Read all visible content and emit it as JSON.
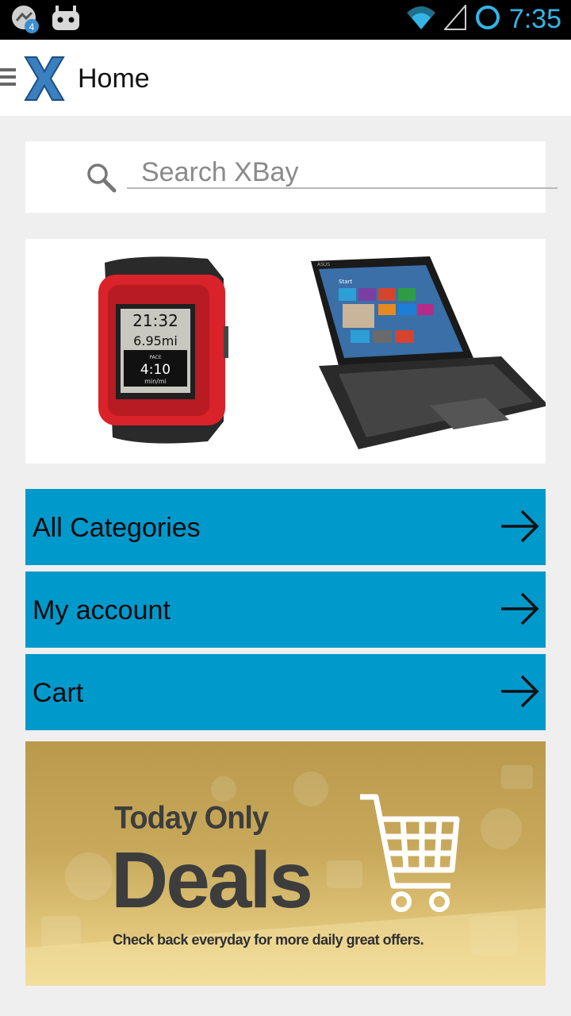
{
  "status_bar": {
    "notification_count": "4",
    "time": "7:35"
  },
  "app_bar": {
    "title": "Home"
  },
  "search": {
    "placeholder": "Search XBay"
  },
  "banner": {
    "watch": {
      "time": "21:32",
      "distance": "6.95mi",
      "pace_label": "PACE",
      "pace": "4:10",
      "pace_unit": "min/mi"
    },
    "tablet": {
      "brand": "ASUS",
      "screen_label": "Start"
    }
  },
  "menu": [
    {
      "label": "All Categories"
    },
    {
      "label": "My account"
    },
    {
      "label": "Cart"
    }
  ],
  "deals_banner": {
    "line1": "Today Only",
    "line2": "Deals",
    "line3": "Check back everyday for more daily great offers."
  },
  "colors": {
    "accent": "#0099cc",
    "status_icon": "#33b5e5"
  }
}
